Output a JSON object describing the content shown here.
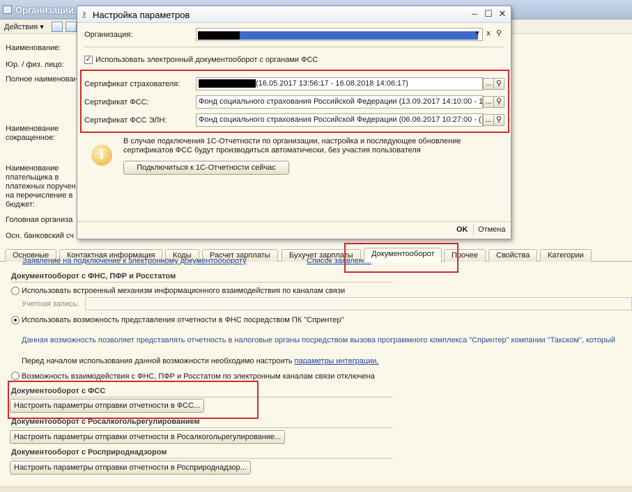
{
  "back_window": {
    "title": "Организации:",
    "toolbar": {
      "actions": "Действия"
    },
    "left_labels": [
      "Наименование:",
      "Юр. / физ. лицо:",
      "Полное наименован",
      "Наименование",
      "сокращенное:",
      "Наименование",
      "плательщика в",
      "платежных поручен",
      "на перечисление в",
      "бюджет:",
      "Головная организа",
      "Осн. банковский сч"
    ],
    "tabs": [
      "Основные",
      "Контактная информация",
      "Коды",
      "Расчет зарплаты",
      "Бухучет зарплаты",
      "Документооборот",
      "Прочее",
      "Свойства",
      "Категории"
    ],
    "active_tab": "Документооборот",
    "link_partial_1": "Заявление на подключение к электронному документообороту",
    "link_partial_2": "Список заявлений",
    "group_fns": "Документооборот с ФНС, ПФР и Росстатом",
    "radio_builtin": "Использовать встроенный механизм информационного взаимодействия по каналам связи",
    "account_label": "Учетная запись:",
    "radio_sprinter": "Использовать возможность представления отчетности в ФНС посредством ПК \"Спринтер\"",
    "sprinter_note": "Данная возможность позволяет представлять отчетность в налоговые органы посредством вызова программного комплекса \"Спринтер\" компании \"Такском\", который",
    "before_use_text": "Перед началом использования данной возможности необходимо настроить",
    "integration_link": "параметры интеграции.",
    "radio_disabled": "Возможность взаимодействия с ФНС, ПФР и Росстатом по электронным каналам связи отключена",
    "group_fss": "Документооборот с ФСС",
    "btn_fss": "Настроить параметры отправки отчетности в ФСС...",
    "group_ral": "Документооборот с Росалкогольрегулированием",
    "btn_ral": "Настроить параметры отправки отчетности в Росалкогольрегулирование...",
    "group_rpn": "Документооборот с Росприроднадзором",
    "btn_rpn": "Настроить параметры отправки отчетности в Росприроднадзор..."
  },
  "dialog": {
    "title": "Настройка параметров",
    "org_label": "Организация:",
    "use_edo_checkbox": "Использовать электронный документооборот с органами ФСС",
    "use_edo_checked": true,
    "cert_insurer_label": "Сертификат страхователя:",
    "cert_insurer_value": "(16.05.2017 13:56:17 - 16.08.2018 14:06:17)",
    "cert_fss_label": "Сертификат ФСС:",
    "cert_fss_value": "Фонд социального страхования Российской Федерации (13.09.2017 14:10:00 - 1",
    "cert_eln_label": "Сертификат ФСС ЭЛН:",
    "cert_eln_value": "Фонд социального страхования Российской Федерации (06.06.2017 10:27:00 - (",
    "info_text_1": "В случае подключения 1С-Отчетности по организации, настройка и последующее обновление",
    "info_text_2": "сертификатов ФСС будут производиться автоматически, без участия пользователя",
    "connect_button": "Подключиться к 1С-Отчетности сейчас",
    "ok": "OK",
    "cancel": "Отмена",
    "dots": "...",
    "clear": "x"
  },
  "colors": {
    "highlight": "#d22a2a",
    "link": "#1b3f9c",
    "accent_bar": "#4169c8"
  }
}
